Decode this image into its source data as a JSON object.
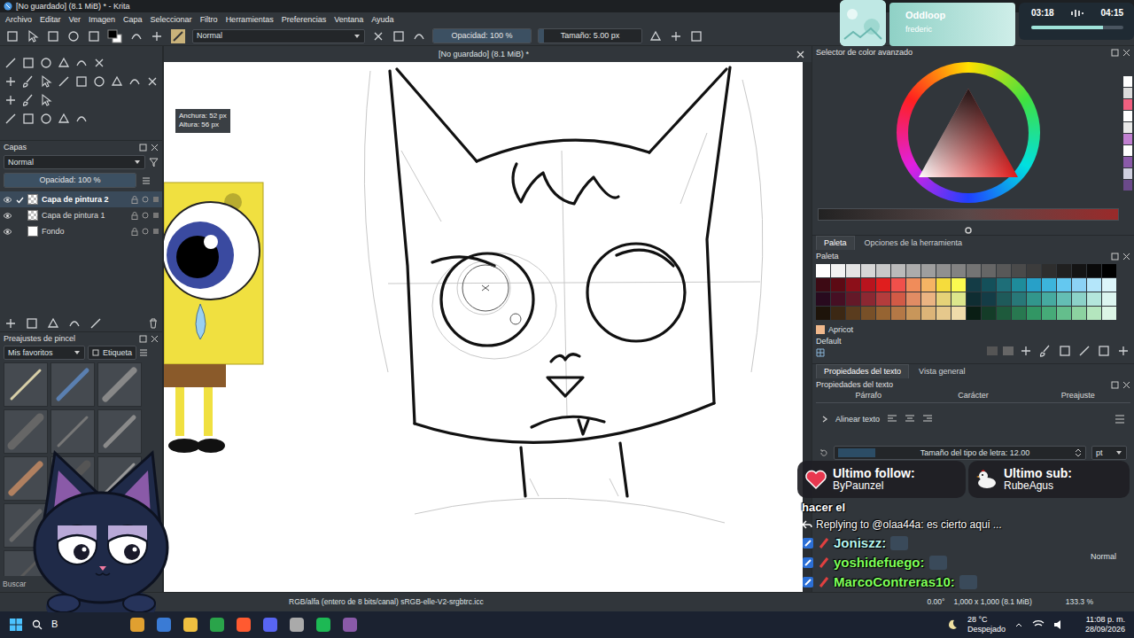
{
  "window": {
    "title": "[No guardado] (8.1 MiB) * - Krita"
  },
  "menu": [
    "Archivo",
    "Editar",
    "Ver",
    "Imagen",
    "Capa",
    "Seleccionar",
    "Filtro",
    "Herramientas",
    "Preferencias",
    "Ventana",
    "Ayuda"
  ],
  "toolbar": {
    "blend_mode": "Normal",
    "opacity": {
      "label": "Opacidad: 100 %",
      "level": 1
    },
    "size": {
      "label": "Tamaño: 5.00 px",
      "level": 0.05
    }
  },
  "layers": {
    "title": "Capas",
    "blend_mode": "Normal",
    "opacity": {
      "label": "Opacidad: 100 %",
      "level": 1
    },
    "items": [
      {
        "name": "Capa de pintura 2",
        "selected": true,
        "visible": true
      },
      {
        "name": "Capa de pintura 1",
        "selected": false,
        "visible": true
      },
      {
        "name": "Fondo",
        "selected": false,
        "visible": true
      }
    ]
  },
  "brushes": {
    "title": "Preajustes de pincel",
    "tag": "Mis favoritos",
    "tag_button": "Etiqueta",
    "search": "Buscar"
  },
  "document": {
    "tab": "[No guardado] (8.1 MiB) *",
    "tooltip": {
      "width": "Anchura: 52 px",
      "height": "Altura: 56 px"
    }
  },
  "status_bar": {
    "color_space": "RGB/alfa (entero de 8 bits/canal) sRGB-elle-V2-srgbtrc.icc",
    "angle": "0.00°",
    "image_size": "1,000 x 1,000 (8.1 MiB)",
    "zoom": "133.3 %"
  },
  "color_selector": {
    "title": "Selector de color avanzado",
    "recent": [
      "#ffffff",
      "#dcdcdc",
      "#f06080",
      "#ffffff",
      "#e8e8e8",
      "#c080d0",
      "#ffffff",
      "#8a5aa8",
      "#d0d0e0",
      "#6a4a8a"
    ]
  },
  "palette": {
    "tabs": [
      {
        "label": "Paleta",
        "selected": true
      },
      {
        "label": "Opciones de la herramienta",
        "selected": false
      }
    ],
    "title": "Paleta",
    "rows": [
      [
        "#ffffff",
        "#f2f2f2",
        "#e4e4e4",
        "#d6d6d6",
        "#c8c8c8",
        "#bababa",
        "#acacac",
        "#9e9e9e",
        "#909090",
        "#828282",
        "#747474",
        "#666666",
        "#585858",
        "#4a4a4a",
        "#3c3c3c",
        "#2e2e2e",
        "#202020",
        "#141414",
        "#0a0a0a",
        "#000000"
      ],
      [
        "#3d0a14",
        "#5c0a14",
        "#8c0f19",
        "#b8141e",
        "#e01e1e",
        "#f0504b",
        "#f08c5a",
        "#f5b464",
        "#f5dc3c",
        "#fafa50",
        "#143c46",
        "#14505a",
        "#1e6e78",
        "#1e8c9b",
        "#28a0c8",
        "#3cb4dc",
        "#64c8f0",
        "#8cd2f5",
        "#b4e6fa",
        "#dcf5fa"
      ],
      [
        "#280a1e",
        "#460f23",
        "#641928",
        "#8c2832",
        "#b43c3c",
        "#d25a46",
        "#e18c64",
        "#ebb482",
        "#e6d278",
        "#dce68c",
        "#0f2d32",
        "#143c46",
        "#1e5a5a",
        "#287878",
        "#32968c",
        "#46aaa0",
        "#64beb4",
        "#8cd2c8",
        "#b4e6dc",
        "#dcf5f0"
      ],
      [
        "#1e140a",
        "#3c2814",
        "#5a3c1e",
        "#785028",
        "#966432",
        "#b47846",
        "#c8965a",
        "#dcb478",
        "#e6c88c",
        "#f0dcaa",
        "#0a1e14",
        "#143c28",
        "#1e5a3c",
        "#287850",
        "#329664",
        "#46aa78",
        "#64be8c",
        "#8cd2a0",
        "#b4e6be",
        "#dcf5e6"
      ]
    ],
    "current": {
      "name": "Apricot",
      "color": "#f0b88c"
    },
    "set": "Default"
  },
  "text_properties": {
    "tabs": [
      {
        "label": "Propiedades del texto",
        "selected": true
      },
      {
        "label": "Vista general",
        "selected": false
      }
    ],
    "title": "Propiedades del texto",
    "sections": [
      "Párrafo",
      "Carácter",
      "Preajuste"
    ],
    "align": {
      "label": "Alinear texto",
      "expanded": false
    },
    "font_size": "Tamaño del tipo de letra: 12.00",
    "unit": "pt",
    "style": "Normal"
  },
  "music": {
    "title": "Oddloop",
    "artist": "frederic",
    "elapsed": "03:18",
    "total": "04:15",
    "level": 0.78
  },
  "alerts": {
    "follow": {
      "label": "Ultimo follow:",
      "name": "ByPaunzel"
    },
    "sub": {
      "label": "Ultimo sub:",
      "name": "RubeAgus"
    }
  },
  "chat": [
    {
      "kind": "text",
      "text": "hacer el"
    },
    {
      "kind": "reply",
      "text": "Replying to @olaa44a: es cierto aqui ..."
    },
    {
      "kind": "message",
      "user": "Joniszz:",
      "color": "#b5f5ee"
    },
    {
      "kind": "message",
      "user": "yoshidefuego:",
      "color": "#7fff5a"
    },
    {
      "kind": "message",
      "user": "MarcoContreras10:",
      "color": "#7fff5a"
    }
  ],
  "taskbar": {
    "search": "B",
    "temperature": "28 °C",
    "weather": "Despejado",
    "time": "11:08 p. m.",
    "date": "28/09/2026"
  }
}
